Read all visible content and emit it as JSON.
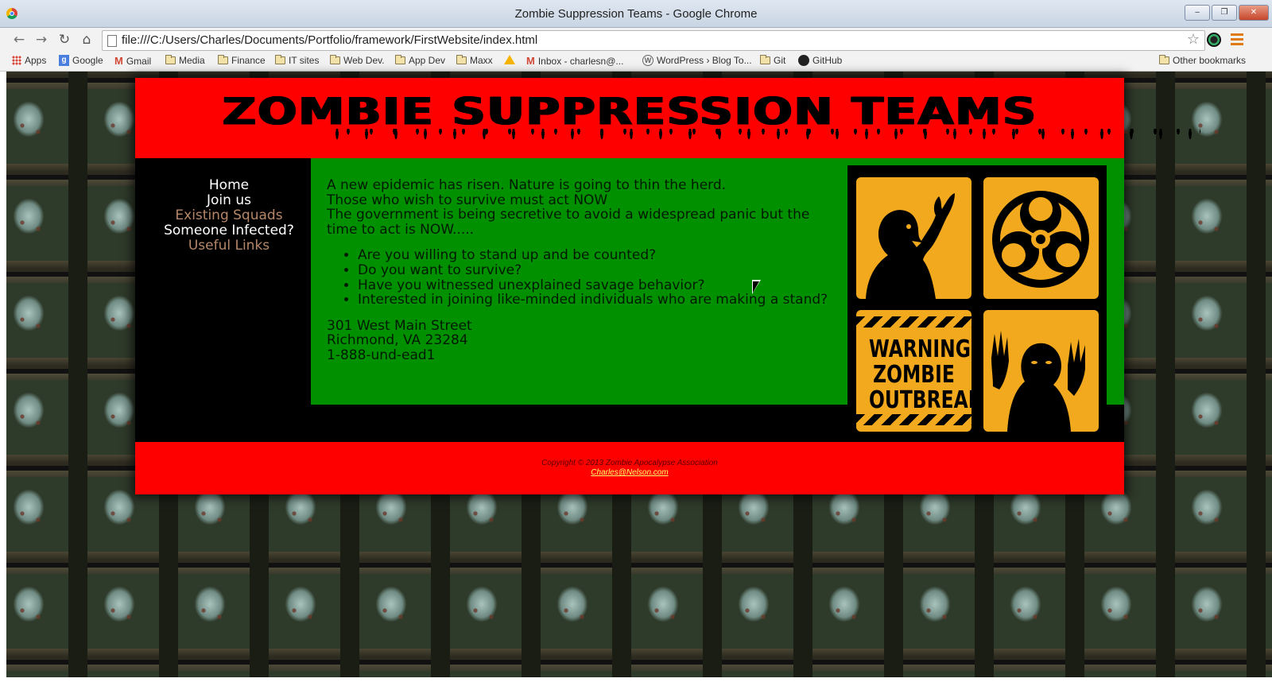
{
  "window": {
    "title": "Zombie Suppression Teams - Google Chrome",
    "min": "‒",
    "restore": "❐",
    "close": "✕"
  },
  "toolbar": {
    "back": "←",
    "forward": "→",
    "reload": "↻",
    "home": "⌂",
    "url": "file:///C:/Users/Charles/Documents/Portfolio/framework/FirstWebsite/index.html",
    "star": "☆"
  },
  "bookmarks": [
    {
      "label": "Apps",
      "icon": "apps-grid-icon"
    },
    {
      "label": "Google",
      "icon": "google-icon"
    },
    {
      "label": "Gmail",
      "icon": "gmail-icon"
    },
    {
      "label": "Media",
      "icon": "folder-icon"
    },
    {
      "label": "Finance",
      "icon": "folder-icon"
    },
    {
      "label": "IT sites",
      "icon": "folder-icon"
    },
    {
      "label": "Web Dev.",
      "icon": "folder-icon"
    },
    {
      "label": "App Dev",
      "icon": "folder-icon"
    },
    {
      "label": "Maxx",
      "icon": "folder-icon"
    },
    {
      "label": "",
      "icon": "drive-icon"
    },
    {
      "label": "Inbox - charlesn@...",
      "icon": "gmail-icon"
    },
    {
      "label": "WordPress › Blog To...",
      "icon": "wordpress-icon"
    },
    {
      "label": "Git",
      "icon": "folder-icon"
    },
    {
      "label": "GitHub",
      "icon": "github-icon"
    }
  ],
  "other_bookmarks": "Other bookmarks",
  "site": {
    "header_title": "ZOMBIE SUPPRESSION TEAMS",
    "nav": [
      {
        "label": "Home",
        "color": "#ffffff"
      },
      {
        "label": "Join us",
        "color": "#ffffff"
      },
      {
        "label": "Existing Squads",
        "color": "#b5876a"
      },
      {
        "label": "Someone Infected?",
        "color": "#ffffff"
      },
      {
        "label": "Useful Links",
        "color": "#b5876a"
      }
    ],
    "intro_lines": [
      "A new epidemic has risen. Nature is going to thin the herd.",
      "Those who wish to survive must act NOW",
      "The government is being secretive to avoid a widespread panic but the time to act is NOW....."
    ],
    "bullets": [
      "Are you willing to stand up and be counted?",
      "Do you want to survive?",
      "Have you witnessed unexplained savage behavior?",
      "Interested in joining like-minded individuals who are making a stand?"
    ],
    "address": [
      "301 West Main Street",
      "Richmond, VA 23284",
      "1-888-und-ead1"
    ],
    "poster": {
      "warning_lines": [
        "WARNING",
        "ZOMBIE",
        "OUTBREAK"
      ]
    },
    "footer": {
      "copyright": "Copyright © 2013 Zombie Apocalypse Association",
      "email": "Charles@Nelson.com"
    },
    "colors": {
      "header_bg": "#ff0000",
      "content_bg": "#009000",
      "nav_bg": "#000000",
      "poster_yellow": "#f2a91d"
    }
  }
}
